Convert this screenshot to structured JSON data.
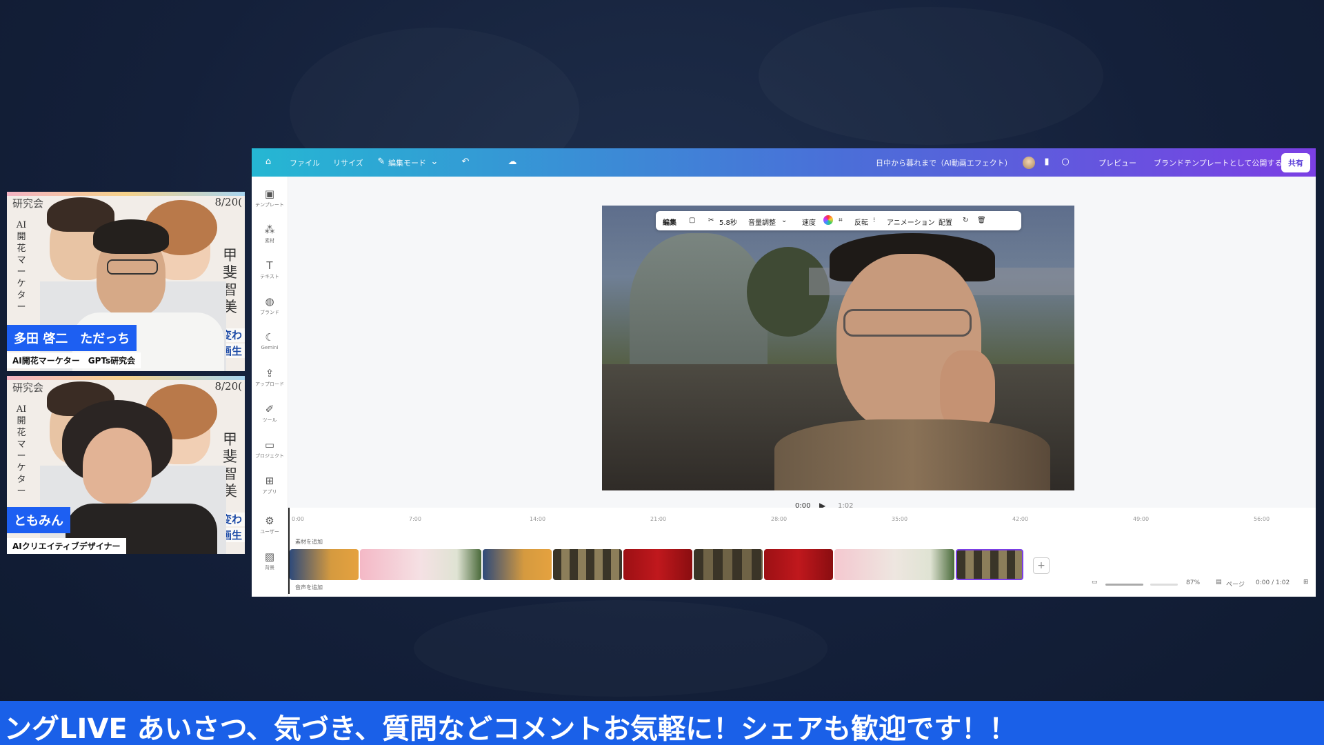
{
  "participants": [
    {
      "name": "多田 啓二　ただっち",
      "role": "AI開花マーケター　GPTs研究会",
      "poster": {
        "left_text": "研究会",
        "vertical": "AI開花マーケター",
        "date": "8/20(",
        "vname": "甲斐智美",
        "banner": "が変わ",
        "banner2": "動画生"
      }
    },
    {
      "name": "ともみん",
      "role": "AIクリエイティブデザイナー",
      "poster": {
        "left_text": "研究会",
        "vertical": "AI開花マーケター",
        "date": "8/20(",
        "vname": "甲斐智美",
        "banner": "が変わ",
        "banner2": "動画生"
      }
    }
  ],
  "editor": {
    "topbar": {
      "file": "ファイル",
      "resize": "リサイズ",
      "edit_mode": "編集モード",
      "title": "日中から暮れまで（AI動画エフェクト）",
      "preview": "プレビュー",
      "publish_template": "ブランドテンプレートとして公開する",
      "share": "共有"
    },
    "sidebar": [
      {
        "label": "テンプレート",
        "icon": "template-icon"
      },
      {
        "label": "素材",
        "icon": "elements-icon"
      },
      {
        "label": "テキスト",
        "icon": "text-icon"
      },
      {
        "label": "ブランド",
        "icon": "brand-icon"
      },
      {
        "label": "Gemini",
        "icon": "gemini-icon"
      },
      {
        "label": "アップロード",
        "icon": "upload-icon"
      },
      {
        "label": "ツール",
        "icon": "draw-icon"
      },
      {
        "label": "プロジェクト",
        "icon": "projects-icon"
      },
      {
        "label": "アプリ",
        "icon": "apps-icon"
      },
      {
        "label": "ユーザー",
        "icon": "user-icon"
      },
      {
        "label": "背景",
        "icon": "background-icon"
      }
    ],
    "video_toolbar": {
      "edit": "編集",
      "duration": "5.8秒",
      "volume": "音量調整",
      "speed": "速度",
      "flip": "反転",
      "animation": "アニメーション",
      "position": "配置"
    },
    "playback": {
      "current": "0:00",
      "total": "1:02"
    },
    "timeline": {
      "ruler": [
        "0:00",
        "7:00",
        "14:00",
        "21:00",
        "28:00",
        "35:00",
        "42:00",
        "49:00",
        "56:00"
      ],
      "add_media": "素材を追加",
      "add_audio": "音声を追加"
    },
    "footer": {
      "zoom": "87%",
      "pages": "ページ",
      "time": "0:00 / 1:02"
    }
  },
  "ticker": "ングLIVE あいさつ、気づき、質問などコメントお気軽に！シェアも歓迎です！！"
}
